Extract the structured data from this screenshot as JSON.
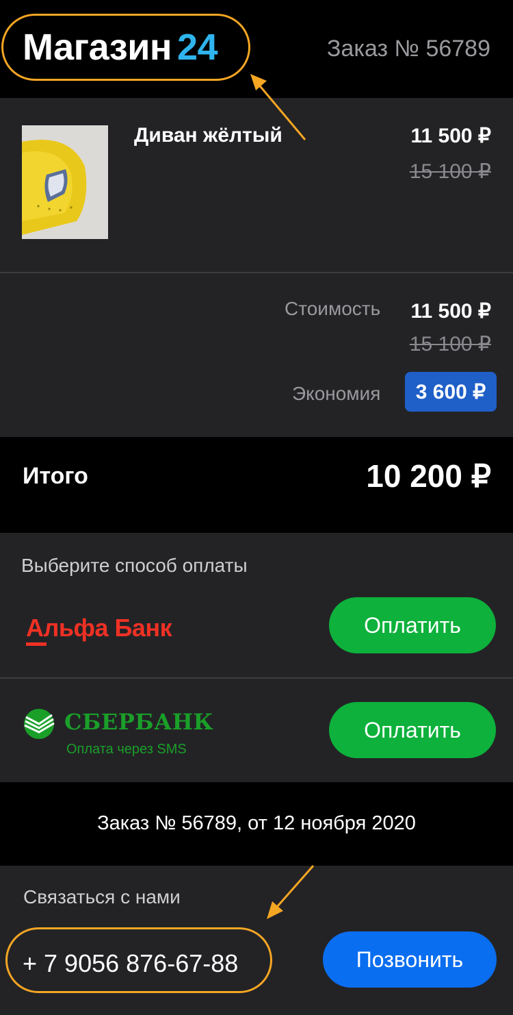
{
  "header": {
    "logo_text": "Магазин",
    "logo_accent": "24",
    "order_number": "Заказ № 56789"
  },
  "product": {
    "name": "Диван жёлтый",
    "price": "11 500 ₽",
    "old_price": "15 100 ₽"
  },
  "summary": {
    "cost_label": "Стоимость",
    "cost_value": "11 500 ₽",
    "cost_old_value": "15 100 ₽",
    "savings_label": "Экономия",
    "savings_value": "3 600 ₽"
  },
  "total": {
    "label": "Итого",
    "value": "10 200 ₽"
  },
  "payment": {
    "title": "Выберите способ оплаты",
    "methods": [
      {
        "name": "Альфа Банк",
        "button": "Оплатить"
      },
      {
        "name": "СБЕРБАНК",
        "subtitle": "Оплата через SMS",
        "button": "Оплатить"
      }
    ]
  },
  "order_info": "Заказ № 56789, от 12 ноября 2020",
  "contact": {
    "title": "Связаться с нами",
    "phone": "+ 7 9056 876-67-88",
    "call_button": "Позвонить"
  },
  "colors": {
    "accent_blue": "#2FB5EE",
    "annotation_orange": "#F5A623",
    "pay_green": "#0DB13B",
    "call_blue": "#0A6EF0",
    "alfa_red": "#EF3124",
    "sber_green": "#1A9F29"
  }
}
